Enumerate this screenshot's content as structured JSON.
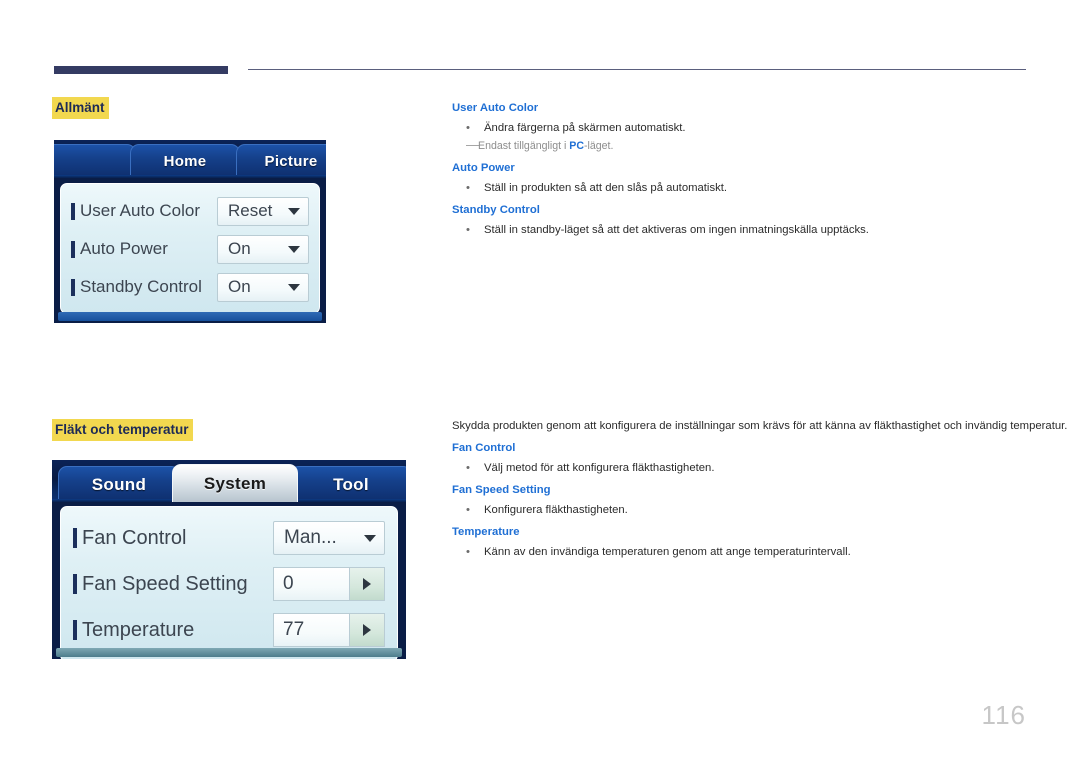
{
  "page": {
    "number": "116"
  },
  "sections": [
    {
      "heading": "Allmänt",
      "osd": {
        "tabs": [
          {
            "label": "Home",
            "active": false
          },
          {
            "label": "Picture",
            "active": false
          },
          {
            "label": "",
            "active": false
          }
        ],
        "rows": [
          {
            "label": "User Auto Color",
            "control": "select",
            "value": "Reset"
          },
          {
            "label": "Auto Power",
            "control": "select",
            "value": "On"
          },
          {
            "label": "Standby Control",
            "control": "select",
            "value": "On"
          }
        ]
      },
      "desc": {
        "lead": "",
        "blocks": [
          {
            "term": "User Auto Color",
            "bullets": [
              "Ändra färgerna på skärmen automatiskt."
            ],
            "note_before": "Endast tillgängligt i ",
            "note_bold": "PC",
            "note_after": "-läget."
          },
          {
            "term": "Auto Power",
            "bullets": [
              "Ställ in produkten så att den slås på automatiskt."
            ]
          },
          {
            "term": "Standby Control",
            "bullets": [
              "Ställ in standby-läget så att det aktiveras om ingen inmatningskälla upptäcks."
            ]
          }
        ]
      }
    },
    {
      "heading": "Fläkt och temperatur",
      "osd": {
        "tabs": [
          {
            "label": "Sound",
            "active": false
          },
          {
            "label": "System",
            "active": true
          },
          {
            "label": "Tool",
            "active": false
          }
        ],
        "rows": [
          {
            "label": "Fan Control",
            "control": "select",
            "value": "Man..."
          },
          {
            "label": "Fan Speed Setting",
            "control": "stepper",
            "value": "0"
          },
          {
            "label": "Temperature",
            "control": "stepper",
            "value": "77"
          }
        ]
      },
      "desc": {
        "lead": "Skydda produkten genom att konfigurera de inställningar som krävs för att känna av fläkthastighet och invändig temperatur.",
        "blocks": [
          {
            "term": "Fan Control",
            "bullets": [
              "Välj metod för att konfigurera fläkthastigheten."
            ]
          },
          {
            "term": "Fan Speed Setting",
            "bullets": [
              "Konfigurera fläkthastigheten."
            ]
          },
          {
            "term": "Temperature",
            "bullets": [
              "Känn av den invändiga temperaturen genom att ange temperaturintervall."
            ]
          }
        ]
      }
    }
  ],
  "glyphs": {
    "bullet_dot": "•",
    "caret_down": "caret-down-icon",
    "caret_right": "caret-right-icon",
    "note_dash": "—"
  },
  "colors": {
    "highlight": "#f2d84f",
    "term_blue": "#1f6fd4",
    "rule_navy": "#343b63",
    "page_number": "#c7c7c7"
  }
}
